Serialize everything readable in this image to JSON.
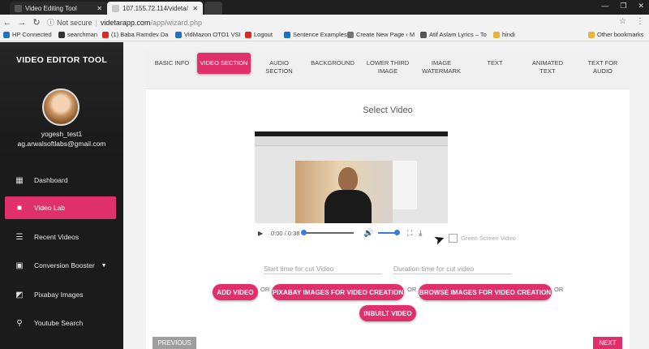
{
  "browser": {
    "tabs": [
      {
        "title": "Video Editing Tool"
      },
      {
        "title": "107.155.72.114/videta/"
      }
    ],
    "url": {
      "secure_label": "Not secure",
      "host": "videtarapp.com",
      "path": "/app/wizard.php"
    },
    "bookmarks": [
      {
        "label": "HP Connected",
        "color": "#1e73be"
      },
      {
        "label": "searchman",
        "color": "#333333"
      },
      {
        "label": "(1) Baba Ramdev Da",
        "color": "#d62d20"
      },
      {
        "label": "VidMazon OTO1 VSI",
        "color": "#1e73be"
      },
      {
        "label": "Logout",
        "color": "#d62d20"
      },
      {
        "label": "Sentence Examples",
        "color": "#1e73be"
      },
      {
        "label": "Create New Page ‹ M",
        "color": "#777777"
      },
      {
        "label": "Atif Aslam Lyrics – To",
        "color": "#555555"
      },
      {
        "label": "hindi",
        "color": "#e7b43c"
      },
      {
        "label": "Other bookmarks",
        "color": "#e7b43c"
      }
    ]
  },
  "sidebar": {
    "app_title": "VIDEO EDITOR TOOL",
    "user": {
      "name": "yogesh_test1",
      "email": "ag.arwalsoftlabs@gmail.com"
    },
    "items": [
      {
        "label": "Dashboard",
        "icon": "dashboard-icon"
      },
      {
        "label": "Video Lab",
        "icon": "videocam-icon"
      },
      {
        "label": "Recent Videos",
        "icon": "list-icon"
      },
      {
        "label": "Conversion Booster",
        "icon": "image-icon"
      },
      {
        "label": "Pixabay Images",
        "icon": "photo-icon"
      },
      {
        "label": "Youtube Search",
        "icon": "search-icon"
      }
    ],
    "active_index": 1
  },
  "wizard": {
    "tabs": [
      "BASIC INFO",
      "VIDEO SECTION",
      "AUDIO SECTION",
      "BACKGROUND",
      "LOWER THIRD IMAGE",
      "IMAGE WATERMARK",
      "TEXT",
      "ANIMATED TEXT",
      "TEXT FOR AUDIO"
    ],
    "active_tab": 1,
    "select_title": "Select Video",
    "player": {
      "time": "0:00 / 0:38",
      "progress": 0,
      "volume": 1.0
    },
    "green_screen_label": "Green Screen Video",
    "start_placeholder": "Start time for cut Video",
    "duration_placeholder": "Duration time for cut video",
    "buttons": {
      "add_video": "ADD VIDEO",
      "pixabay": "PIXABAY IMAGES FOR VIDEO CREATION",
      "browse": "BROWSE IMAGES FOR VIDEO CREATION",
      "inbuilt": "INBUILT VIDEO"
    },
    "or": "OR",
    "previous": "PREVIOUS",
    "next": "NEXT"
  },
  "colors": {
    "accent": "#e0306c",
    "sidebar_bg": "#1b1b1b",
    "player_blue": "#3b7be0"
  }
}
